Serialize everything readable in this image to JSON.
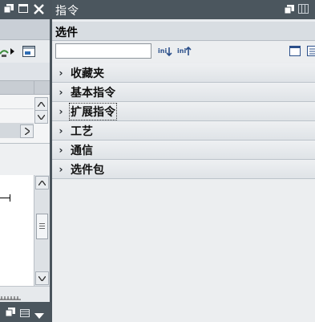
{
  "panel": {
    "title": "指令",
    "options_label": "选件",
    "search": {
      "value": "",
      "placeholder": ""
    },
    "categories": [
      {
        "label": "收藏夹"
      },
      {
        "label": "基本指令"
      },
      {
        "label": "扩展指令"
      },
      {
        "label": "工艺"
      },
      {
        "label": "通信"
      },
      {
        "label": "选件包"
      }
    ],
    "focused_index": 2
  },
  "colors": {
    "titlebar": "#4b565e",
    "panel_bg": "#e9ecef",
    "accent_icon": "#2b4f8a"
  }
}
